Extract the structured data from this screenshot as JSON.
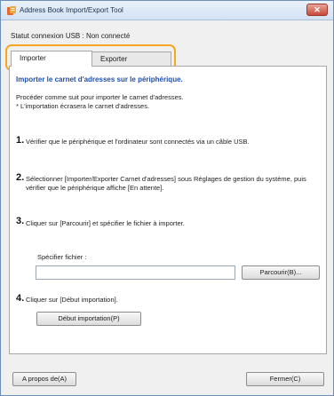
{
  "window": {
    "title": "Address Book Import/Export Tool",
    "close_glyph": "✕"
  },
  "usb_status": "Statut connexion USB : Non connecté",
  "tabs": [
    {
      "label": "Importer",
      "active": true
    },
    {
      "label": "Exporter",
      "active": false
    }
  ],
  "panel": {
    "heading": "Importer le carnet d'adresses sur le périphérique.",
    "intro": [
      "Procéder comme suit pour importer le carnet d'adresses.",
      "* L'importation écrasera le carnet d'adresses."
    ],
    "steps": [
      {
        "num": "1.",
        "text": "Vérifier que le périphérique et l'ordinateur sont connectés via un câble USB."
      },
      {
        "num": "2.",
        "text": "Sélectionner [Importer/Exporter Carnet d'adresses] sous Réglages de gestion du système, puis vérifier que le périphérique affiche [En attente]."
      },
      {
        "num": "3.",
        "text": "Cliquer sur [Parcourir] et spécifier le fichier à importer."
      },
      {
        "num": "4.",
        "text": "Cliquer sur [Début importation]."
      }
    ],
    "file_label": "Spécifier fichier :",
    "file_value": "",
    "browse_label": "Parcourir(B)...",
    "start_label": "Début importation(P)"
  },
  "footer": {
    "about_label": "A propos de(A)",
    "close_label": "Fermer(C)"
  },
  "colors": {
    "heading": "#1f4fa8",
    "tab_highlight": "#f5a623",
    "title_close": "#c8493a"
  }
}
